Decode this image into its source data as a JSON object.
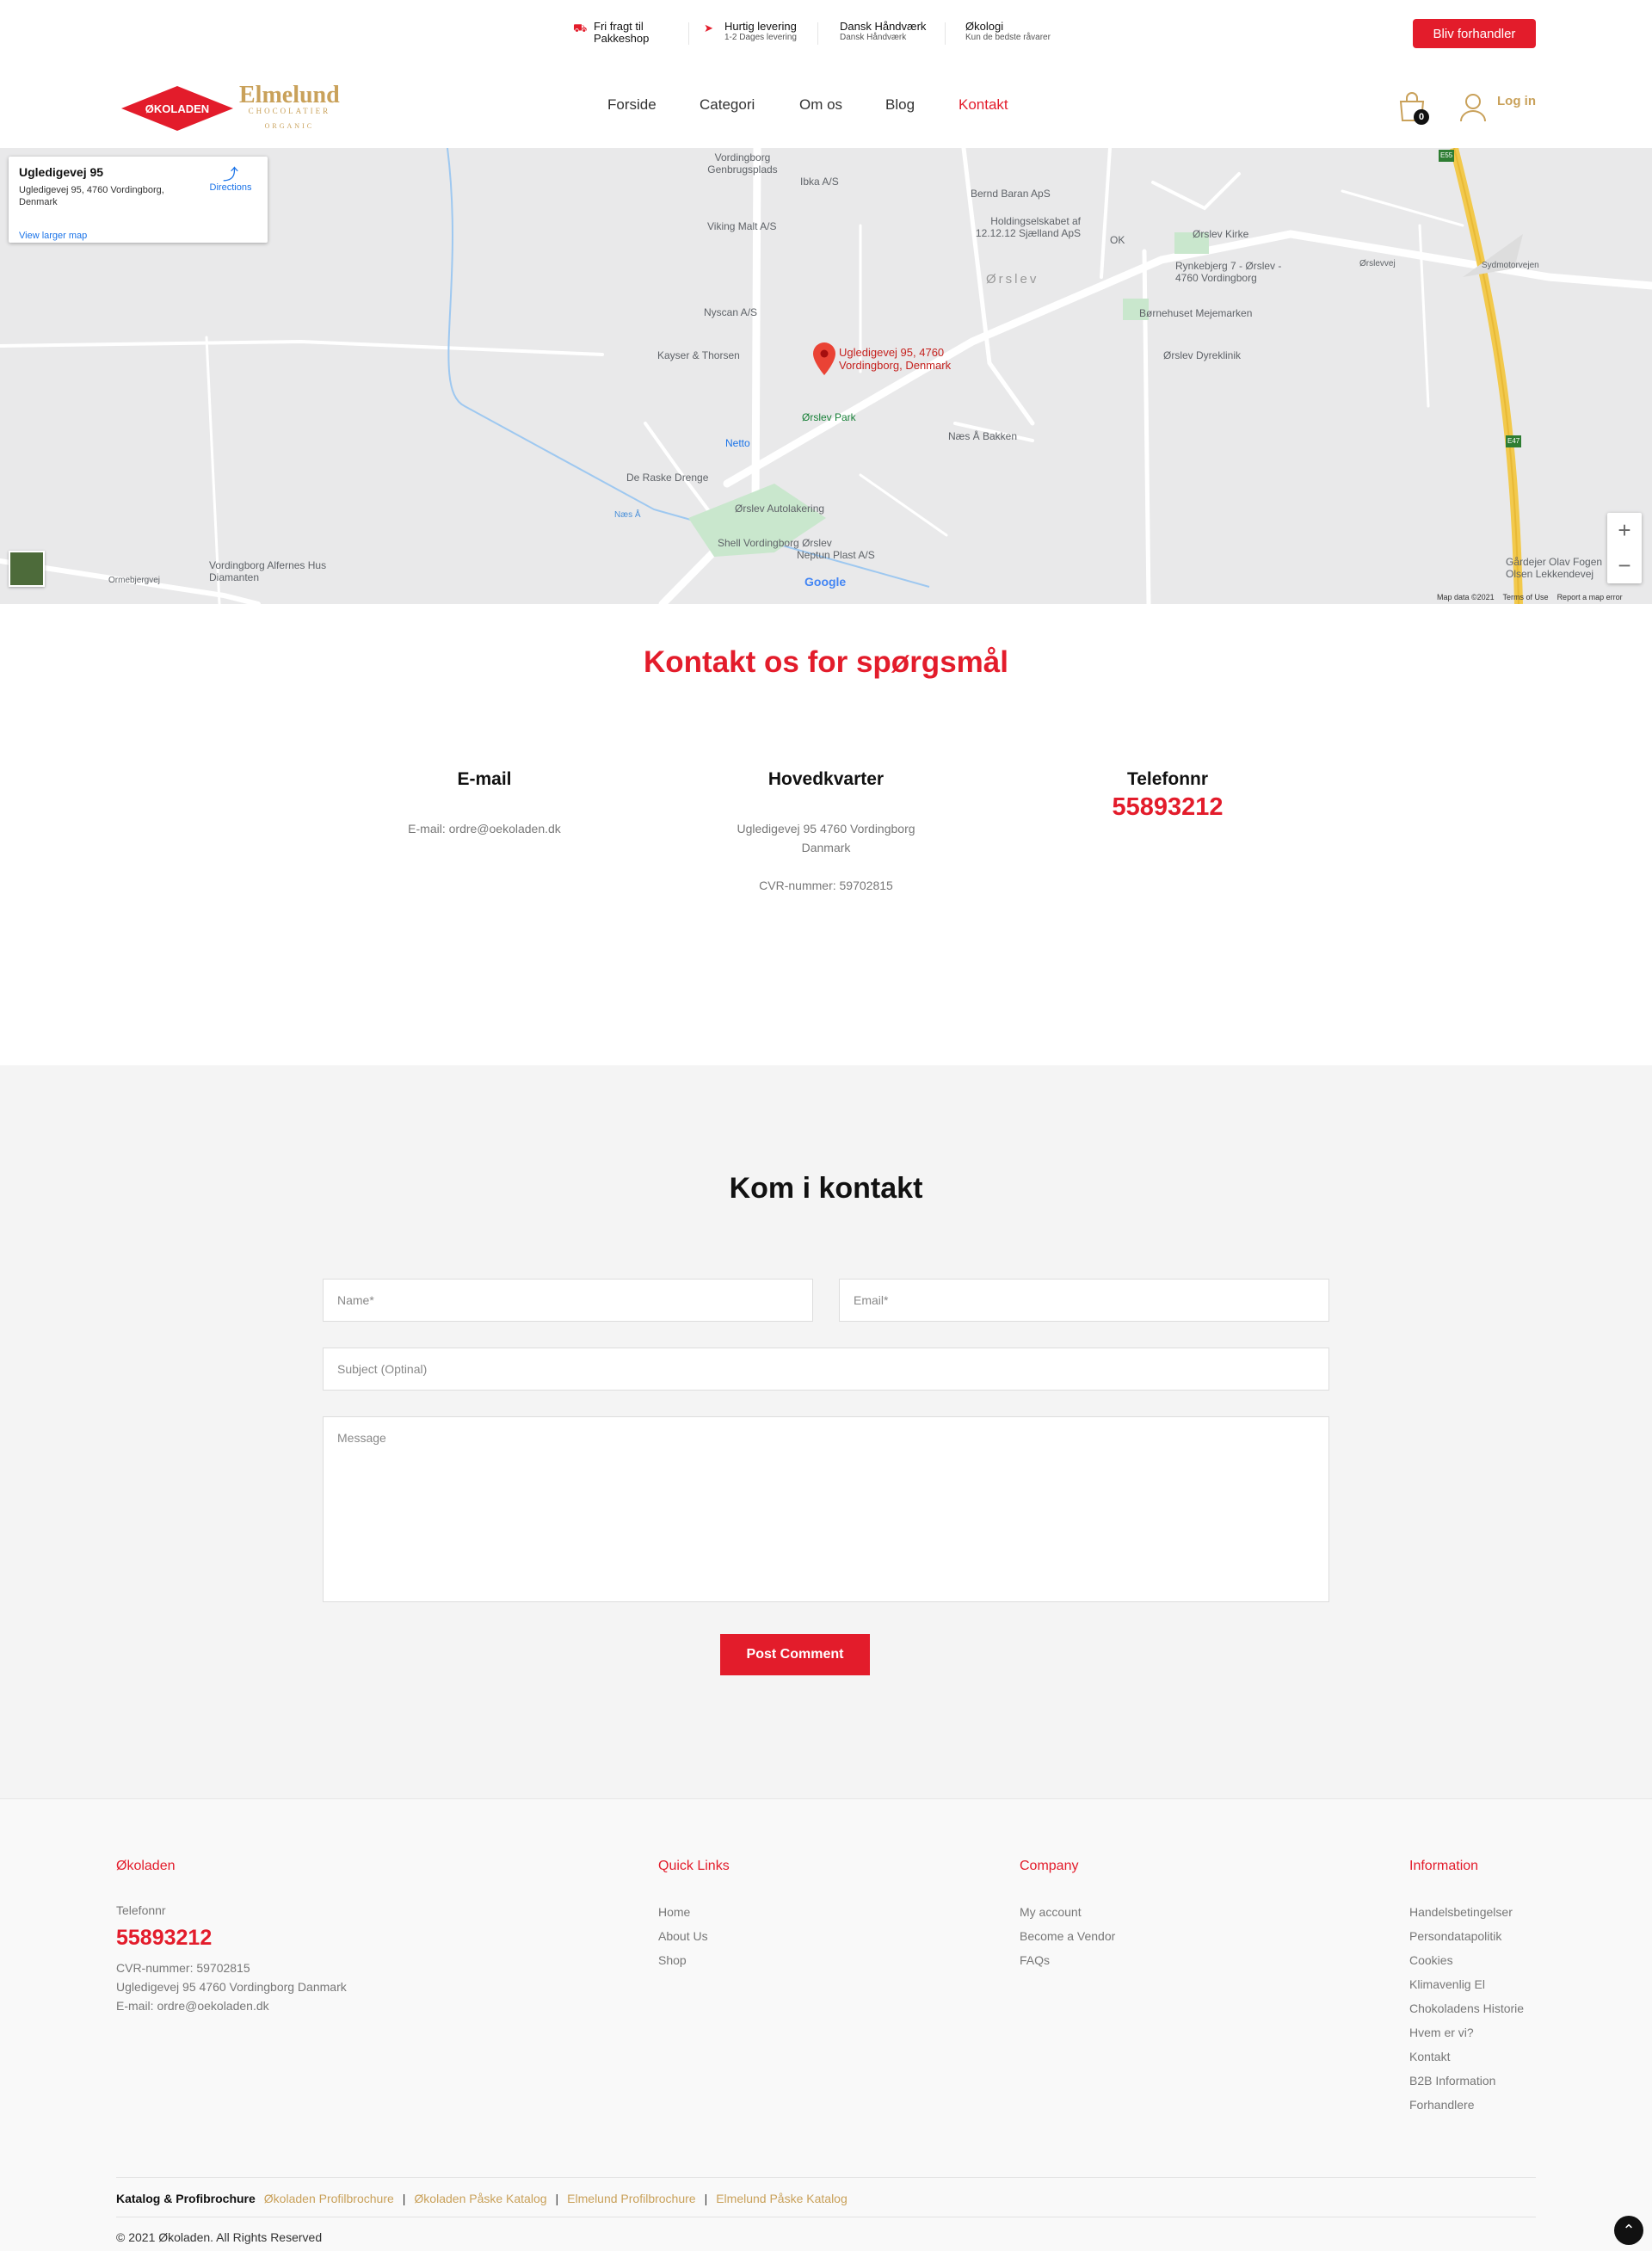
{
  "usps": [
    {
      "title": "Fri fragt til",
      "sub": "Pakkeshop"
    },
    {
      "title": "Hurtig levering",
      "sub": "1-2 Dages levering"
    },
    {
      "title": "Dansk Håndværk",
      "sub": "Dansk Håndværk"
    },
    {
      "title": "Økologi",
      "sub": "Kun de bedste råvarer"
    }
  ],
  "dealer_button": "Bliv forhandler",
  "logo": {
    "red_text": "ØKOLADEN",
    "gold_name": "Elmelund",
    "gold_sub1": "CHOCOLATIER",
    "gold_sub2": "ORGANIC"
  },
  "nav": {
    "items": [
      "Forside",
      "Categori",
      "Om os",
      "Blog",
      "Kontakt"
    ],
    "active": "Kontakt"
  },
  "cart_count": "0",
  "login_label": "Log in",
  "map": {
    "card_title": "Ugledigevej 95",
    "card_address": "Ugledigevej 95, 4760 Vordingborg, Denmark",
    "directions": "Directions",
    "larger_map": "View larger map",
    "pin_label_line1": "Ugledigevej 95, 4760",
    "pin_label_line2": "Vordingborg, Denmark",
    "places": [
      "Vordingborg Genbrugsplads",
      "Ibka A/S",
      "Bernd Baran ApS",
      "Holdingselskabet af 12.12.12 Sjælland ApS",
      "Ørslev Kirke",
      "Viking Malt A/S",
      "Rynkebjerg 7 - Ørslev - 4760 Vordingborg",
      "Nyscan A/S",
      "Kayser & Thorsen",
      "Børnehuset Mejemarken",
      "Ørslev Dyreklinik",
      "Ørslev Park",
      "Næs Å Bakken",
      "Netto",
      "De Raske Drenge",
      "Ørslev Autolakering",
      "Shell Vordingborg Ørslev",
      "Neptun Plast A/S",
      "Vordingborg Alfernes Hus Diamanten",
      "Gårdejer Olav Fogen Olsen Lekkendevej",
      "OK",
      "Ørslev",
      "Ørslevvej",
      "Ormebjergvej",
      "Næs Å",
      "Sydmotorvejen",
      "E55",
      "E47"
    ],
    "google": "Google",
    "map_data": "Map data ©2021",
    "terms": "Terms of Use",
    "report": "Report a map error"
  },
  "contact": {
    "title": "Kontakt os for spørgsmål",
    "email_head": "E-mail",
    "email_text": "E-mail: ordre@oekoladen.dk",
    "hq_head": "Hovedkvarter",
    "hq_line1": "Ugledigevej 95 4760 Vordingborg",
    "hq_line2": "Danmark",
    "hq_cvr": "CVR-nummer: 59702815",
    "phone_head": "Telefonnr",
    "phone": "55893212"
  },
  "form": {
    "title": "Kom i kontakt",
    "name_ph": "Name*",
    "email_ph": "Email*",
    "subject_ph": "Subject (Optinal)",
    "message_ph": "Message",
    "submit": "Post Comment"
  },
  "footer": {
    "brand_head": "Økoladen",
    "phone_label": "Telefonnr",
    "phone": "55893212",
    "cvr": "CVR-nummer: 59702815",
    "address": "Ugledigevej 95 4760 Vordingborg Danmark",
    "email": "E-mail: ordre@oekoladen.dk",
    "quick_head": "Quick Links",
    "quick": [
      "Home",
      "About Us",
      "Shop"
    ],
    "company_head": "Company",
    "company": [
      "My account",
      "Become a Vendor",
      "FAQs"
    ],
    "info_head": "Information",
    "info": [
      "Handelsbetingelser",
      "Persondatapolitik",
      "Cookies",
      "Klimavenlig El",
      "Chokoladens Historie",
      "Hvem er vi?",
      "Kontakt",
      "B2B Information",
      "Forhandlere"
    ],
    "catalog_label": "Katalog & Profibrochure",
    "catalogs": [
      "Økoladen Profilbrochure",
      "Økoladen Påske Katalog",
      "Elmelund Profilbrochure",
      "Elmelund Påske Katalog"
    ],
    "copyright": "© 2021 Økoladen. All Rights Reserved"
  },
  "colors": {
    "brand_red": "#e31c2b",
    "gold": "#c9a15a",
    "footer_bg": "#f9f9f9",
    "form_bg": "#f4f4f4"
  }
}
